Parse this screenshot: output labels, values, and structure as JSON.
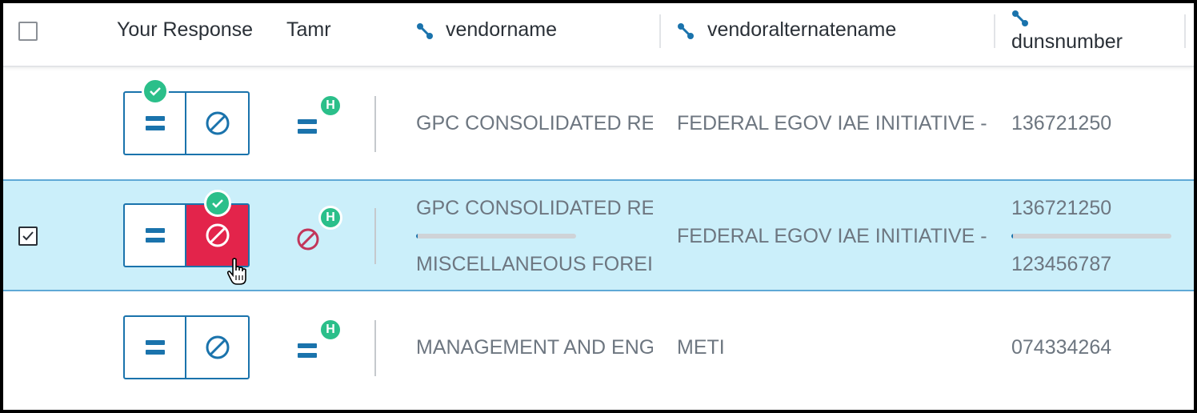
{
  "header": {
    "your_response": "Your Response",
    "tamr": "Tamr",
    "vendorname": "vendorname",
    "vendoralternatename": "vendoralternatename",
    "dunsnumber": "dunsnumber",
    "select_all_checked": false
  },
  "icons": {
    "column_link": "link-icon",
    "same": "equals-icon",
    "different": "not-allowed-icon",
    "verified": "check-icon",
    "high_confidence": "H"
  },
  "colors": {
    "accent": "#1a73ac",
    "reject": "#e3244b",
    "verified": "#2bbf8a",
    "selected_row": "#cbeffa"
  },
  "rows": [
    {
      "checked": false,
      "response": "same",
      "tamr_label": "H",
      "tamr_prediction": "same",
      "vendorname": "GPC CONSOLIDATED REPORTING",
      "vendoralternatename": "FEDERAL EGOV IAE INITIATIVE - GSA",
      "dunsnumber": "136721250"
    },
    {
      "checked": true,
      "response": "different",
      "tamr_label": "H",
      "tamr_prediction": "different",
      "vendorname_a": "GPC CONSOLIDATED REPORTING",
      "vendorname_b": "MISCELLANEOUS FOREIGN AWARDEES",
      "vendorname_similarity": 0.01,
      "vendoralternatename": "FEDERAL EGOV IAE INITIATIVE - GSA",
      "dunsnumber_a": "136721250",
      "dunsnumber_b": "123456787",
      "dunsnumber_similarity": 0.01
    },
    {
      "checked": false,
      "response": "none",
      "tamr_label": "H",
      "tamr_prediction": "same",
      "vendorname": "MANAGEMENT AND ENGINEERING",
      "vendoralternatename": "METI",
      "dunsnumber": "074334264"
    }
  ]
}
